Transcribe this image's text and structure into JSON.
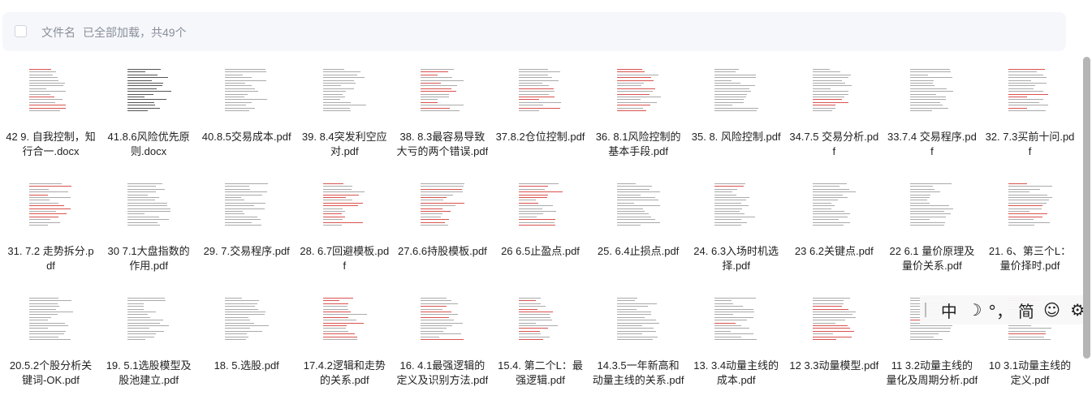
{
  "header": {
    "column_label": "文件名",
    "load_status": "已全部加载，共49个"
  },
  "files": [
    {
      "name": "42 9. 自我控制，知行合一.docx",
      "ink": "red"
    },
    {
      "name": "41.8.6风险优先原则.docx",
      "ink": "dark"
    },
    {
      "name": "40.8.5交易成本.pdf",
      "ink": "gray"
    },
    {
      "name": "39. 8.4突发利空应对.pdf",
      "ink": "gray"
    },
    {
      "name": "38. 8.3最容易导致大亏的两个错误.pdf",
      "ink": "red"
    },
    {
      "name": "37.8.2仓位控制.pdf",
      "ink": "red"
    },
    {
      "name": "36. 8.1风险控制的基本手段.pdf",
      "ink": "red"
    },
    {
      "name": "35. 8. 风险控制.pdf",
      "ink": "gray"
    },
    {
      "name": "34.7.5 交易分析.pdf",
      "ink": "red"
    },
    {
      "name": "33.7.4 交易程序.pdf",
      "ink": "gray"
    },
    {
      "name": "32. 7.3买前十问.pdf",
      "ink": "red"
    },
    {
      "name": "31. 7.2 走势拆分.pdf",
      "ink": "red"
    },
    {
      "name": "30 7.1大盘指数的作用.pdf",
      "ink": "gray"
    },
    {
      "name": "29. 7.交易程序.pdf",
      "ink": "gray"
    },
    {
      "name": "28. 6.7回避模板.pdf",
      "ink": "red"
    },
    {
      "name": "27.6.6持股模板.pdf",
      "ink": "red"
    },
    {
      "name": "26 6.5止盈点.pdf",
      "ink": "red"
    },
    {
      "name": "25. 6.4止损点.pdf",
      "ink": "gray"
    },
    {
      "name": "24. 6.3入场时机选择.pdf",
      "ink": "red"
    },
    {
      "name": "23 6.2关键点.pdf",
      "ink": "gray"
    },
    {
      "name": "22 6.1 量价原理及量价关系.pdf",
      "ink": "gray"
    },
    {
      "name": "21. 6、第三个L：量价择时.pdf",
      "ink": "red"
    },
    {
      "name": "20.5.2个股分析关键词-OK.pdf",
      "ink": "gray"
    },
    {
      "name": "19. 5.1选股模型及股池建立.pdf",
      "ink": "gray"
    },
    {
      "name": "18. 5.选股.pdf",
      "ink": "gray"
    },
    {
      "name": "17.4.2逻辑和走势的关系.pdf",
      "ink": "red"
    },
    {
      "name": "16. 4.1最强逻辑的定义及识别方法.pdf",
      "ink": "red"
    },
    {
      "name": "15.4. 第二个L：最强逻辑.pdf",
      "ink": "red"
    },
    {
      "name": "14.3.5一年新高和动量主线的关系.pdf",
      "ink": "gray"
    },
    {
      "name": "13. 3.4动量主线的成本.pdf",
      "ink": "red"
    },
    {
      "name": "12 3.3动量模型.pdf",
      "ink": "red"
    },
    {
      "name": "11 3.2动量主线的量化及周期分析.pdf",
      "ink": "red"
    },
    {
      "name": "10 3.1动量主线的定义.pdf",
      "ink": "red"
    }
  ],
  "ime_toolbar": {
    "mode": "中",
    "moon_icon": "☽",
    "punct": "°，",
    "script": "简",
    "emoji_icon": "☺",
    "settings_icon": "⚙"
  }
}
